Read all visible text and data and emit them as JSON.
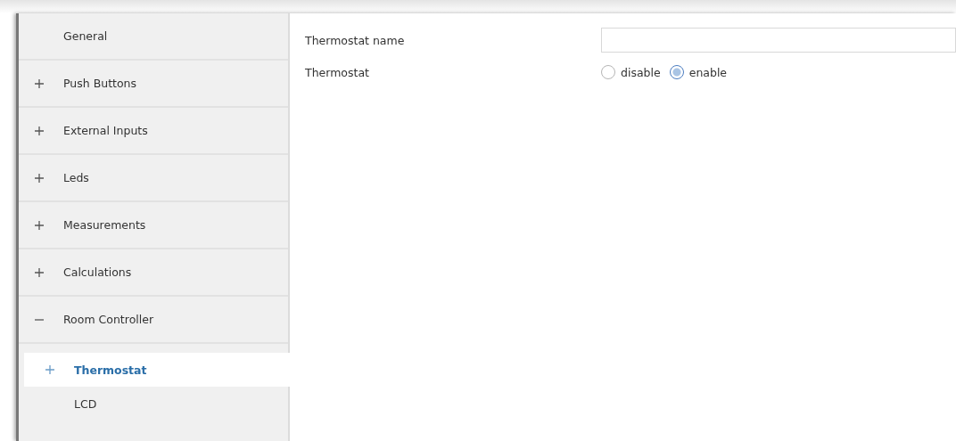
{
  "sidebar": {
    "items": [
      {
        "label": "General",
        "kind": "page",
        "selected": false
      },
      {
        "label": "Push Buttons",
        "kind": "group",
        "expanded": false,
        "selected": false
      },
      {
        "label": "External Inputs",
        "kind": "group",
        "expanded": false,
        "selected": false
      },
      {
        "label": "Leds",
        "kind": "group",
        "expanded": false,
        "selected": false
      },
      {
        "label": "Measurements",
        "kind": "group",
        "expanded": false,
        "selected": false
      },
      {
        "label": "Calculations",
        "kind": "group",
        "expanded": false,
        "selected": false
      },
      {
        "label": "Room Controller",
        "kind": "group",
        "expanded": true,
        "selected": false,
        "children": [
          {
            "label": "Thermostat",
            "kind": "group",
            "expanded": false,
            "selected": true
          },
          {
            "label": "LCD",
            "kind": "page",
            "selected": false
          }
        ]
      }
    ]
  },
  "parameters": [
    {
      "kind": "text",
      "label": "Thermostat name"
    },
    {
      "kind": "radio",
      "label": "Thermostat",
      "options": [
        {
          "label": "disable",
          "selected": false
        },
        {
          "label": "enable",
          "selected": true
        }
      ]
    }
  ]
}
